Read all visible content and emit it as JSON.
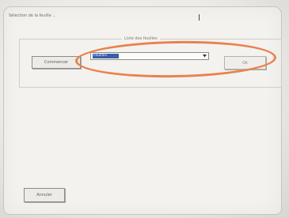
{
  "window": {
    "title": "Sélection de la feuille ..."
  },
  "frame": {
    "label": "Liste des feuilles"
  },
  "left_button": {
    "label": "Commencer"
  },
  "combo": {
    "selected_value": "Feuille1"
  },
  "right_button": {
    "label": "Ok"
  },
  "cancel_button": {
    "label": "Annuler"
  },
  "colors": {
    "selection": "#3a5fa8",
    "annotation": "#e9824d"
  }
}
